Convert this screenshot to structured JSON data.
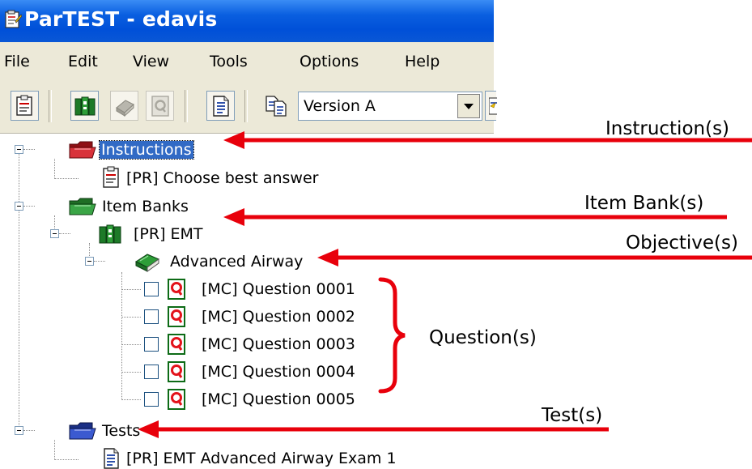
{
  "window": {
    "title": "ParTEST - edavis"
  },
  "menu": [
    "File",
    "Edit",
    "View",
    "Tools",
    "Options",
    "Help"
  ],
  "toolbar": {
    "version_select": "Version A"
  },
  "tree": {
    "instructions": "Instructions",
    "instruction_item": "[PR] Choose best answer",
    "item_banks": "Item Banks",
    "bank": "[PR] EMT",
    "objective": "Advanced Airway",
    "questions": [
      "[MC] Question 0001",
      "[MC] Question 0002",
      "[MC] Question 0003",
      "[MC] Question 0004",
      "[MC] Question 0005"
    ],
    "tests": "Tests",
    "test_item": "[PR] EMT Advanced Airway Exam 1"
  },
  "annotations": {
    "instruction": "Instruction(s)",
    "item_bank": "Item Bank(s)",
    "objective": "Objective(s)",
    "question": "Question(s)",
    "test": "Test(s)"
  },
  "colors": {
    "arrow": "#e8000b",
    "titlebar": "#0a5fe0",
    "selection": "#316ac5",
    "folder_green": "#2f8f2f",
    "folder_red": "#c8282d",
    "folder_blue": "#2a49b8"
  }
}
